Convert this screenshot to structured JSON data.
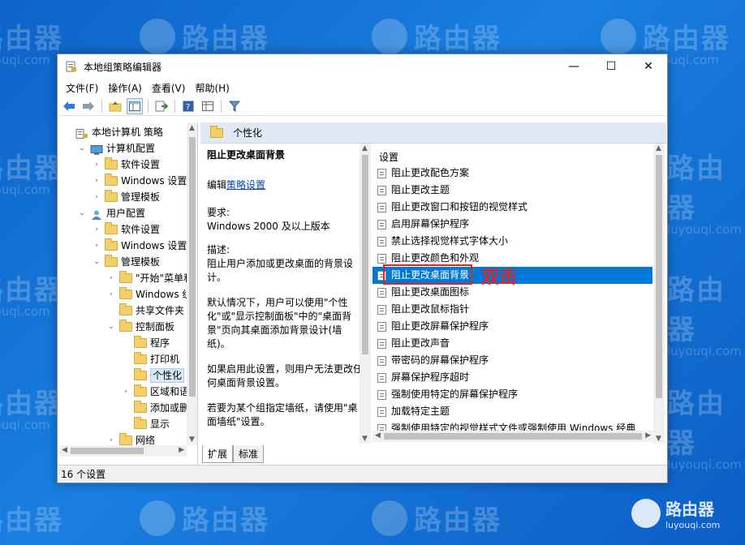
{
  "watermark": {
    "brand": "路由器",
    "url": "luyouqi.com",
    "corner_url": "luyouqi.com"
  },
  "window": {
    "title": "本地组策略编辑器",
    "controls": {
      "minimize": "—",
      "maximize": "☐",
      "close": "✕"
    }
  },
  "menu": {
    "file": "文件(F)",
    "action": "操作(A)",
    "view": "查看(V)",
    "help": "帮助(H)"
  },
  "tree": {
    "items": [
      {
        "label": "本地计算机 策略",
        "expander": "",
        "icon": "computer-policy-icon"
      },
      {
        "label": "计算机配置",
        "expander": "⌄",
        "icon": "computer-icon"
      },
      {
        "label": "软件设置",
        "expander": "›",
        "icon": "folder-icon"
      },
      {
        "label": "Windows 设置",
        "expander": "›",
        "icon": "folder-icon"
      },
      {
        "label": "管理模板",
        "expander": "›",
        "icon": "folder-icon"
      },
      {
        "label": "用户配置",
        "expander": "⌄",
        "icon": "user-icon"
      },
      {
        "label": "软件设置",
        "expander": "›",
        "icon": "folder-icon"
      },
      {
        "label": "Windows 设置",
        "expander": "›",
        "icon": "folder-icon"
      },
      {
        "label": "管理模板",
        "expander": "⌄",
        "icon": "folder-icon"
      },
      {
        "label": "\"开始\"菜单和",
        "expander": "›",
        "icon": "folder-icon"
      },
      {
        "label": "Windows 组",
        "expander": "›",
        "icon": "folder-icon"
      },
      {
        "label": "共享文件夹",
        "expander": "",
        "icon": "folder-icon"
      },
      {
        "label": "控制面板",
        "expander": "⌄",
        "icon": "folder-icon"
      },
      {
        "label": "程序",
        "expander": "",
        "icon": "folder-icon"
      },
      {
        "label": "打印机",
        "expander": "",
        "icon": "folder-icon"
      },
      {
        "label": "个性化",
        "expander": "",
        "icon": "folder-icon",
        "selected": true
      },
      {
        "label": "区域和语言",
        "expander": "›",
        "icon": "folder-icon"
      },
      {
        "label": "添加或删除",
        "expander": "",
        "icon": "folder-icon"
      },
      {
        "label": "显示",
        "expander": "",
        "icon": "folder-icon"
      },
      {
        "label": "网络",
        "expander": "›",
        "icon": "folder-icon"
      }
    ]
  },
  "right": {
    "header": "个性化",
    "description": {
      "title": "阻止更改桌面背景",
      "edit_prefix": "编辑",
      "edit_link": "策略设置",
      "requirements_label": "要求:",
      "requirements": "Windows 2000 及以上版本",
      "description_label": "描述:",
      "description": "阻止用户添加或更改桌面的背景设计。",
      "default_text": "默认情况下，用户可以使用\"个性化\"或\"显示控制面板\"中的\"桌面背景\"页向其桌面添加背景设计(墙纸)。",
      "enabled_text": "如果启用此设置，则用户无法更改任何桌面背景设置。",
      "wallpaper_text": "若要为某个组指定墙纸，请使用\"桌面墙纸\"设置。"
    },
    "settings_header": "设置",
    "settings": [
      "阻止更改配色方案",
      "阻止更改主题",
      "阻止更改窗口和按钮的视觉样式",
      "启用屏幕保护程序",
      "禁止选择视觉样式字体大小",
      "阻止更改颜色和外观",
      "阻止更改桌面背景",
      "阻止更改桌面图标",
      "阻止更改鼠标指针",
      "阻止更改屏幕保护程序",
      "阻止更改声音",
      "带密码的屏幕保护程序",
      "屏幕保护程序超时",
      "强制使用特定的屏幕保护程序",
      "加载特定主题",
      "强制使用特定的视觉样式文件或强制使用 Windows 经典"
    ],
    "selected_index": 6,
    "annotation": "双击",
    "tabs": {
      "expanded": "扩展",
      "standard": "标准"
    }
  },
  "status": {
    "text": "16 个设置"
  },
  "colors": {
    "selection": "#0078d7",
    "annotation": "#e0241e",
    "desktop": "#1a7fe0"
  }
}
